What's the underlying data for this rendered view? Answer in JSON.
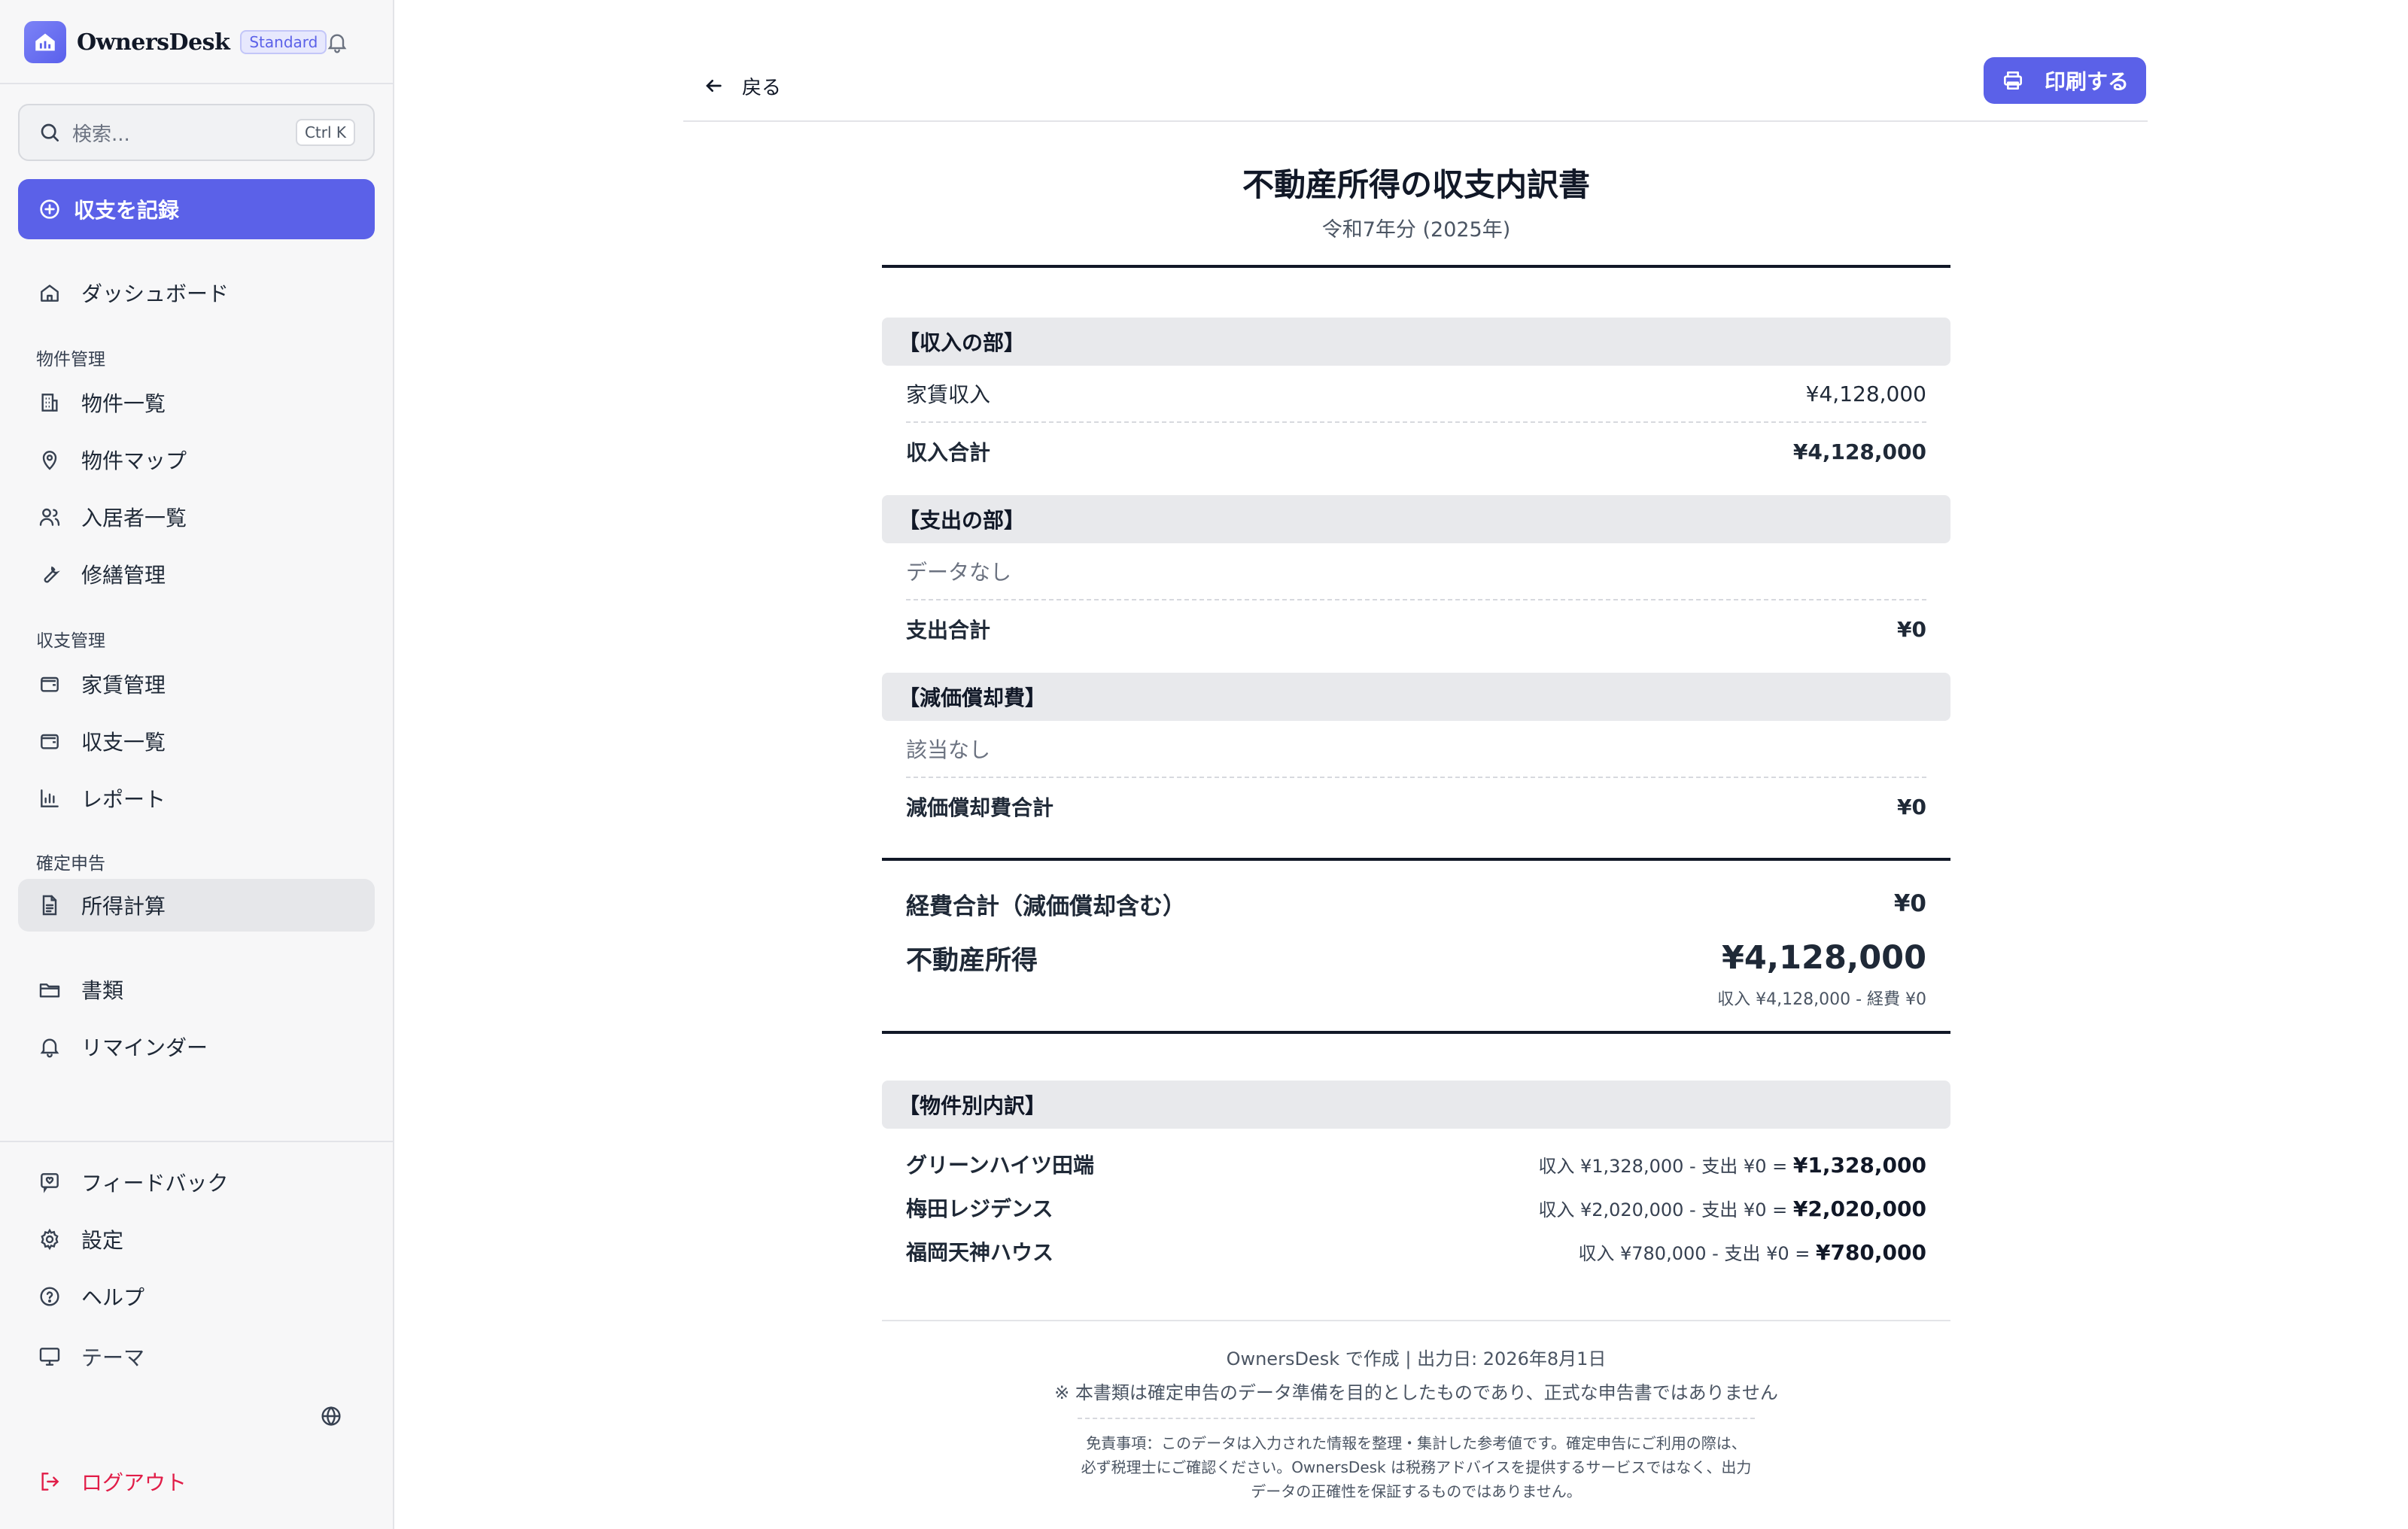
{
  "app": {
    "name": "OwnersDesk",
    "plan": "Standard"
  },
  "search": {
    "placeholder": "検索...",
    "shortcut": "Ctrl K"
  },
  "sidebar": {
    "record_button": "収支を記録",
    "dashboard": "ダッシュボード",
    "sections": {
      "property": "物件管理",
      "finance": "収支管理",
      "tax": "確定申告"
    },
    "items": {
      "property_list": "物件一覧",
      "property_map": "物件マップ",
      "tenants": "入居者一覧",
      "repairs": "修繕管理",
      "rent": "家賃管理",
      "transactions": "収支一覧",
      "reports": "レポート",
      "income_calc": "所得計算",
      "documents": "書類",
      "reminders": "リマインダー",
      "feedback": "フィードバック",
      "settings": "設定",
      "help": "ヘルプ",
      "theme": "テーマ",
      "logout": "ログアウト"
    }
  },
  "toolbar": {
    "back": "戻る",
    "print": "印刷する"
  },
  "statement": {
    "title": "不動産所得の収支内訳書",
    "subtitle": "令和7年分 (2025年)",
    "income": {
      "header": "【収入の部】",
      "rent_label": "家賃収入",
      "rent_value": "¥4,128,000",
      "total_label": "収入合計",
      "total_value": "¥4,128,000"
    },
    "expense": {
      "header": "【支出の部】",
      "empty": "データなし",
      "total_label": "支出合計",
      "total_value": "¥0"
    },
    "depreciation": {
      "header": "【減価償却費】",
      "empty": "該当なし",
      "total_label": "減価償却費合計",
      "total_value": "¥0"
    },
    "summary": {
      "expense_total_label": "経費合計（減価償却含む）",
      "expense_total_value": "¥0",
      "income_label": "不動産所得",
      "income_value": "¥4,128,000",
      "income_note": "収入 ¥4,128,000 - 経費 ¥0"
    },
    "by_property": {
      "header": "【物件別内訳】",
      "rows": [
        {
          "name": "グリーンハイツ田端",
          "calc": "収入 ¥1,328,000 - 支出 ¥0 =",
          "net": "¥1,328,000"
        },
        {
          "name": "梅田レジデンス",
          "calc": "収入 ¥2,020,000 - 支出 ¥0 =",
          "net": "¥2,020,000"
        },
        {
          "name": "福岡天神ハウス",
          "calc": "収入 ¥780,000 - 支出 ¥0 =",
          "net": "¥780,000"
        }
      ]
    },
    "footer": {
      "generated": "OwnersDesk で作成 | 出力日: 2026年8月1日",
      "notice": "※ 本書類は確定申告のデータ準備を目的としたものであり、正式な申告書ではありません",
      "disclaimer_1": "免責事項：このデータは入力された情報を整理・集計した参考値です。確定申告にご利用の際は、",
      "disclaimer_2": "必ず税理士にご確認ください。OwnersDesk は税務アドバイスを提供するサービスではなく、出力",
      "disclaimer_3": "データの正確性を保証するものではありません。"
    }
  }
}
